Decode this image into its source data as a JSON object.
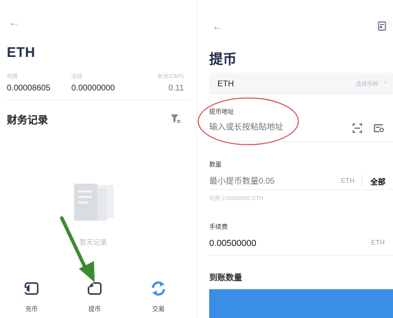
{
  "left": {
    "back_icon": "arrow-left-icon",
    "asset_name": "ETH",
    "balances": [
      {
        "label": "可用",
        "value": "0.00008605"
      },
      {
        "label": "冻结",
        "value": "0.00000000"
      },
      {
        "label": "折合(CNY)",
        "value": "0.11"
      }
    ],
    "records_title": "财务记录",
    "filter_icon": "filter-icon",
    "empty_text": "暂无记录",
    "actions": [
      {
        "label": "充币",
        "icon": "deposit-icon"
      },
      {
        "label": "提币",
        "icon": "withdraw-icon"
      },
      {
        "label": "交易",
        "icon": "trade-refresh-icon"
      }
    ],
    "arrow_color": "#3c8a2e"
  },
  "right": {
    "back_icon": "arrow-left-icon",
    "records_icon": "records-icon",
    "title": "提币",
    "coin": "ETH",
    "select_coin": "选择币种",
    "address_label": "提币地址",
    "address_placeholder": "输入或长按粘贴地址",
    "amount_label": "数量",
    "amount_placeholder": "最小提币数量0.05",
    "amount_unit": "ETH",
    "all_label": "全部",
    "available": "可用 0.00008605 ETH",
    "fee_label": "手续费",
    "fee_value": "0.00500000",
    "fee_unit": "ETH",
    "arrive_label": "到账数量",
    "submit_color": "#3a8ee6",
    "highlight_color": "#d9313a"
  }
}
